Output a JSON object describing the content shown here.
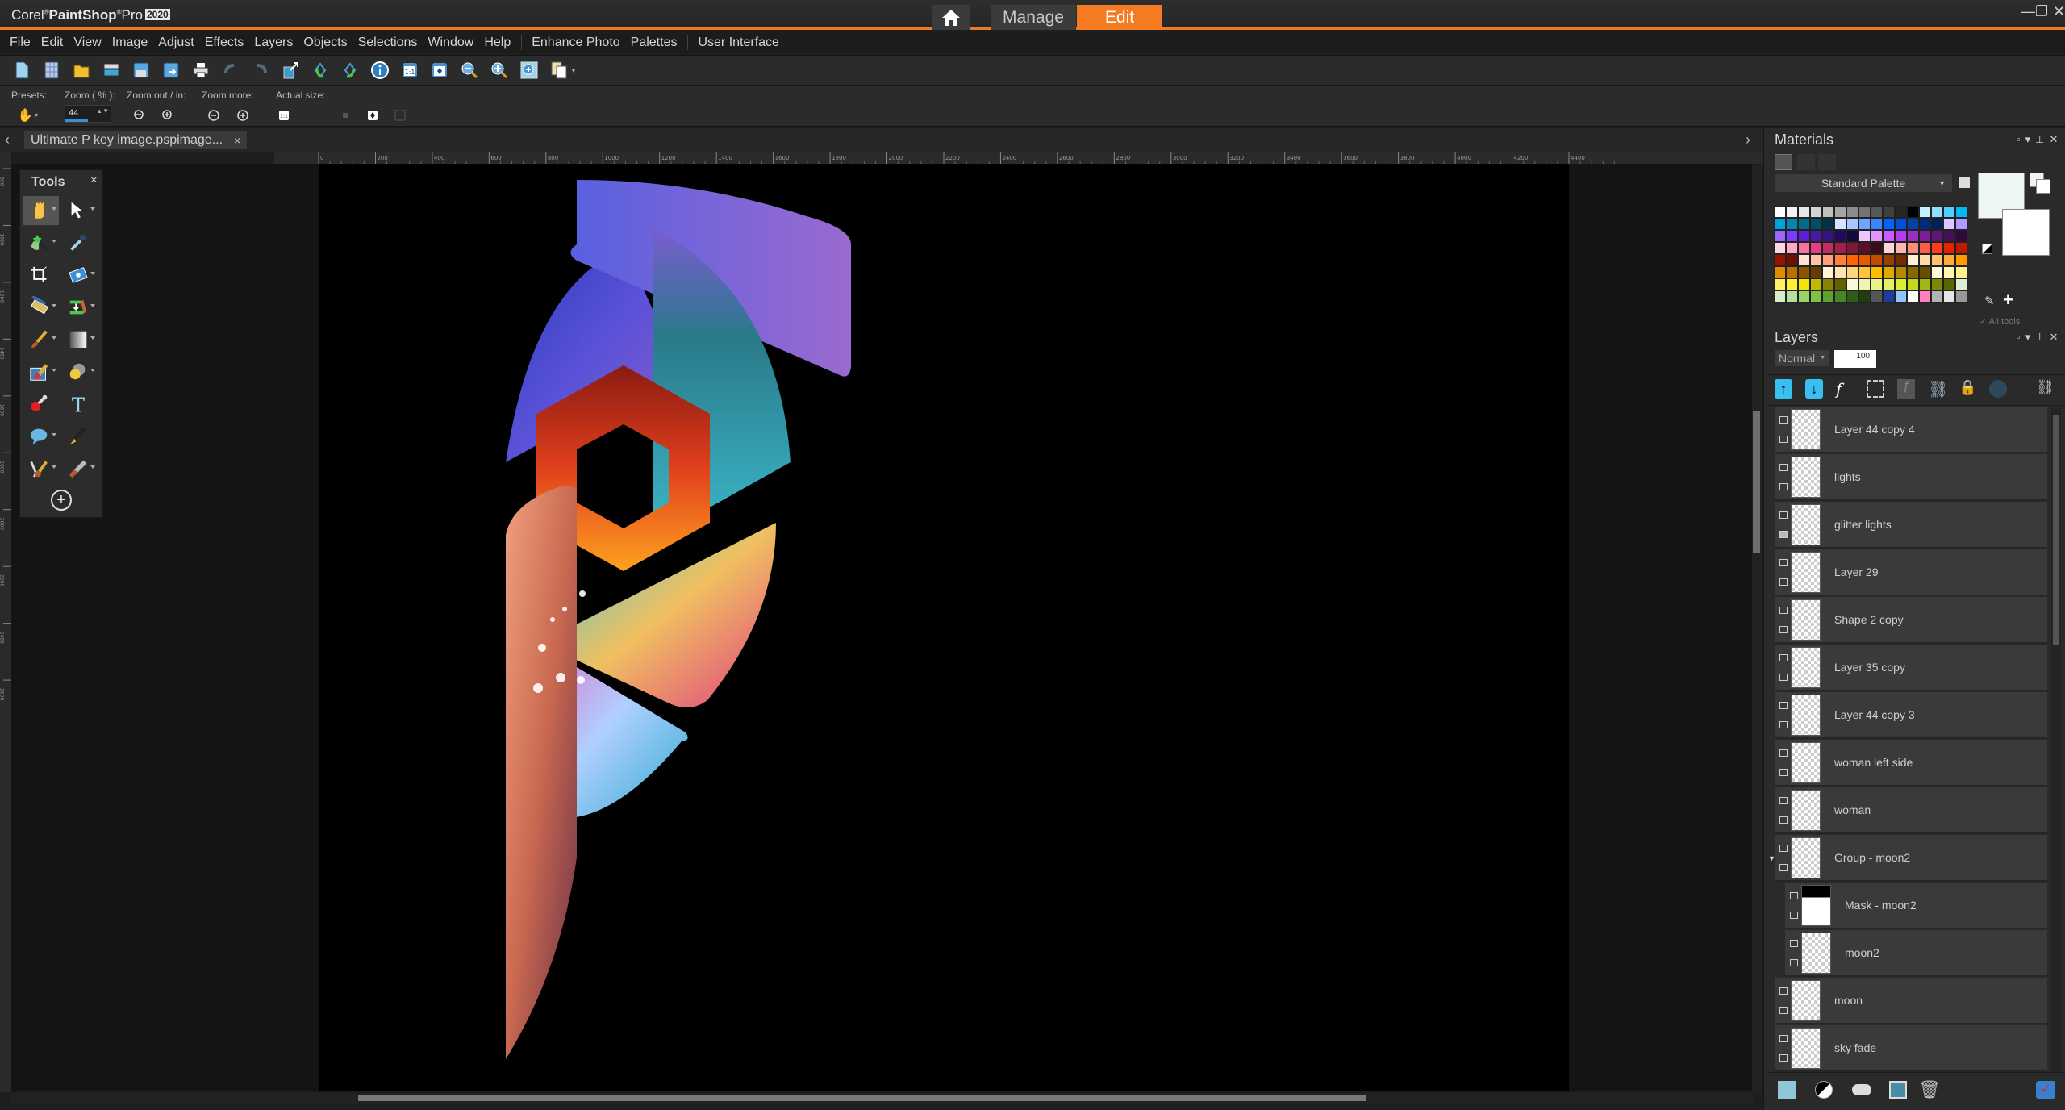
{
  "app": {
    "brand_corel": "Corel",
    "brand_product": "PaintShop",
    "brand_pro": "Pro",
    "brand_year": "2020"
  },
  "workspace_tabs": [
    {
      "label": "",
      "icon": "home-icon",
      "active": false
    },
    {
      "label": "Manage",
      "active": false
    },
    {
      "label": "Edit",
      "active": true
    }
  ],
  "window_controls": {
    "minimize": "—",
    "restore": "❐",
    "close": "✕"
  },
  "menu": [
    "File",
    "Edit",
    "View",
    "Image",
    "Adjust",
    "Effects",
    "Layers",
    "Objects",
    "Selections",
    "Window",
    "Help",
    "Enhance Photo",
    "Palettes",
    "User Interface"
  ],
  "toolbar": {
    "buttons": [
      "new-document",
      "new-from-template",
      "open",
      "scan",
      "save",
      "save-as",
      "print",
      "undo",
      "redo",
      "resize",
      "rotate-left",
      "rotate-right",
      "image-info",
      "actual-size",
      "fit-to-window",
      "zoom-out",
      "zoom-in",
      "zoom-window",
      "paste-menu"
    ]
  },
  "tool_options": {
    "presets_label": "Presets:",
    "zoom_label": "Zoom ( % ):",
    "zoom_value": "44",
    "zoom_out_in_label": "Zoom out / in:",
    "zoom_more_label": "Zoom more:",
    "actual_size_label": "Actual size:"
  },
  "document": {
    "tab_title": "Ultimate P key image.pspimage...",
    "close": "×",
    "nav_left": "‹",
    "nav_right": "›"
  },
  "ruler": {
    "h_ticks": [
      "0",
      "200",
      "400",
      "600",
      "800",
      "1000",
      "1200",
      "1400",
      "1600",
      "1800",
      "2000",
      "2200",
      "2400",
      "2600",
      "2800",
      "3000",
      "3200",
      "3400",
      "3600",
      "3800",
      "4000",
      "4200",
      "4400"
    ],
    "v_ticks": [
      "800",
      "1000",
      "1200",
      "1400",
      "1600",
      "1800",
      "2000",
      "2200",
      "2400",
      "2600"
    ]
  },
  "tools_palette": {
    "title": "Tools",
    "close": "×",
    "tools": [
      {
        "name": "pan-tool",
        "active": true,
        "dropdown": true
      },
      {
        "name": "pick-tool",
        "dropdown": true
      },
      {
        "name": "magic-wand-tool",
        "dropdown": true
      },
      {
        "name": "dropper-tool",
        "dropdown": false
      },
      {
        "name": "crop-tool",
        "dropdown": false
      },
      {
        "name": "straighten-tool",
        "dropdown": true
      },
      {
        "name": "red-eye-tool",
        "dropdown": true
      },
      {
        "name": "clone-tool",
        "dropdown": true
      },
      {
        "name": "paint-brush-tool",
        "dropdown": true
      },
      {
        "name": "gradient-fill-tool",
        "dropdown": true
      },
      {
        "name": "eraser-tool",
        "dropdown": true
      },
      {
        "name": "smudge-tool",
        "dropdown": true
      },
      {
        "name": "lighten-darken-tool",
        "dropdown": false
      },
      {
        "name": "text-tool",
        "dropdown": false
      },
      {
        "name": "preset-shape-tool",
        "dropdown": true
      },
      {
        "name": "pen-tool",
        "dropdown": false
      },
      {
        "name": "art-media-tool",
        "dropdown": true
      },
      {
        "name": "palette-knife-tool",
        "dropdown": true
      }
    ],
    "add_tools": "+"
  },
  "materials": {
    "title": "Materials",
    "palette_select": "Standard Palette",
    "all_tools_label": "All tools",
    "all_tools_checked": true,
    "foreground_color": "#eef6f2",
    "background_color": "#ffffff",
    "swatches": [
      "#ffffff",
      "#f2f2f2",
      "#e6e6e6",
      "#d4d4d4",
      "#bfbfbf",
      "#a6a6a6",
      "#8c8c8c",
      "#737373",
      "#595959",
      "#404040",
      "#262626",
      "#000000",
      "#c5efff",
      "#8fdfff",
      "#4fcfff",
      "#00b9f2",
      "#00a3d9",
      "#0088b0",
      "#006b8a",
      "#004d66",
      "#003347",
      "#d6e6ff",
      "#a8c8ff",
      "#70a4ff",
      "#3d85ff",
      "#0062ff",
      "#0050d9",
      "#0041aa",
      "#002b80",
      "#00215c",
      "#d9c9ff",
      "#b399ff",
      "#9966ff",
      "#7a3dff",
      "#5c1fd9",
      "#461aa3",
      "#331480",
      "#1f0d5c",
      "#14093d",
      "#ecc6ff",
      "#e095ff",
      "#cc5cff",
      "#b33cf2",
      "#9a2fc4",
      "#7d1e9e",
      "#5e167a",
      "#46105c",
      "#2e0a3d",
      "#ffd6e6",
      "#ffa8c8",
      "#f2759c",
      "#e63d80",
      "#c22c63",
      "#a3204d",
      "#7d1838",
      "#5c1028",
      "#3d0a1a",
      "#ffd6d6",
      "#ffb3b3",
      "#ff8c7d",
      "#ff5c4a",
      "#ff3d1a",
      "#e62200",
      "#c21a00",
      "#991400",
      "#700e00",
      "#ffe1d6",
      "#ffc2a8",
      "#ffa07d",
      "#ff8040",
      "#ff6600",
      "#e65a00",
      "#c24d00",
      "#993d00",
      "#702e00",
      "#fff0d6",
      "#ffd9a8",
      "#ffc270",
      "#ffaa3d",
      "#ff9d00",
      "#e08a00",
      "#b87000",
      "#8a5400",
      "#663d00",
      "#fff3d6",
      "#ffe4b3",
      "#ffd47d",
      "#ffc43d",
      "#ffbf00",
      "#e0a800",
      "#b88a00",
      "#8a6800",
      "#664d00",
      "#fffadb",
      "#fff7b3",
      "#fff28a",
      "#fff066",
      "#ffee33",
      "#f2e600",
      "#c2b800",
      "#8a8400",
      "#666100",
      "#fafadb",
      "#f2f2b3",
      "#eaf28a",
      "#e1f066",
      "#d9ed33",
      "#c4d91a",
      "#a3b80f",
      "#7d8a00",
      "#5c6600",
      "#e0edd6",
      "#d6efc9",
      "#b6e0a0",
      "#98d46b",
      "#7cc244",
      "#5ea330",
      "#478526",
      "#2f5c18",
      "#213d10",
      "#555555",
      "#1a3d9e",
      "#8cc8ff",
      "#ffffff",
      "#ff7fbf",
      "#b3b3b3",
      "#e6e6e6",
      "#999999"
    ]
  },
  "layers": {
    "title": "Layers",
    "blend_mode": "Normal",
    "opacity": "100",
    "items": [
      {
        "name": "Layer 44 copy 4",
        "visible": true,
        "type": "raster",
        "depth": 0
      },
      {
        "name": "lights",
        "visible": true,
        "type": "raster",
        "depth": 0
      },
      {
        "name": "glitter lights",
        "visible": false,
        "type": "raster",
        "depth": 0
      },
      {
        "name": "Layer 29",
        "visible": true,
        "type": "raster",
        "depth": 0
      },
      {
        "name": "Shape 2 copy",
        "visible": true,
        "type": "raster",
        "depth": 0
      },
      {
        "name": "Layer 35 copy",
        "visible": true,
        "type": "raster",
        "depth": 0
      },
      {
        "name": "Layer 44 copy 3",
        "visible": true,
        "type": "raster",
        "depth": 0
      },
      {
        "name": "woman left side",
        "visible": true,
        "type": "raster",
        "depth": 0
      },
      {
        "name": "woman",
        "visible": true,
        "type": "raster",
        "depth": 0
      },
      {
        "name": "Group - moon2",
        "visible": true,
        "type": "group",
        "depth": 0,
        "expanded": true
      },
      {
        "name": "Mask - moon2",
        "visible": true,
        "type": "mask",
        "depth": 1
      },
      {
        "name": "moon2",
        "visible": true,
        "type": "raster",
        "depth": 1
      },
      {
        "name": "moon",
        "visible": true,
        "type": "raster",
        "depth": 0
      },
      {
        "name": "sky fade",
        "visible": true,
        "type": "raster",
        "depth": 0
      }
    ],
    "bottom_buttons": [
      "new-raster-layer",
      "new-adjustment-layer",
      "new-mask-layer",
      "promote-layer",
      "delete-layer",
      "edit-selected"
    ]
  },
  "colors": {
    "accent": "#f47b20",
    "panel_bg": "#2a2a2a",
    "canvas_bg": "#000000"
  }
}
